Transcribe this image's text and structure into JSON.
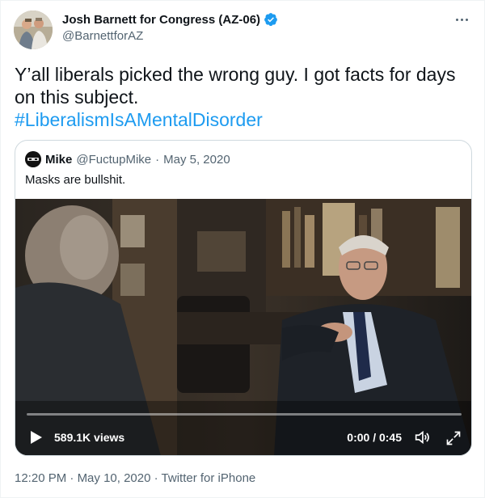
{
  "author": {
    "display_name": "Josh Barnett for Congress (AZ-06)",
    "handle": "@BarnettforAZ",
    "verified": true
  },
  "tweet": {
    "text": "Y’all liberals picked the wrong guy. I got facts for days on this subject.",
    "hashtag": "#LiberalismIsAMentalDisorder"
  },
  "quoted": {
    "name": "Mike",
    "handle": "@FuctupMike",
    "separator": "·",
    "date": "May 5, 2020",
    "text": "Masks are bullshit."
  },
  "video": {
    "views": "589.1K views",
    "time": "0:00 / 0:45",
    "progress": 0
  },
  "meta": {
    "time": "12:20 PM",
    "separator1": "·",
    "date": "May 10, 2020",
    "separator2": "·",
    "source": "Twitter for iPhone"
  },
  "colors": {
    "accent": "#1d9bf0",
    "text_primary": "#0f1419",
    "text_secondary": "#536471"
  },
  "icons": [
    "more-icon",
    "verified-icon",
    "play-icon",
    "volume-icon",
    "fullscreen-icon"
  ]
}
